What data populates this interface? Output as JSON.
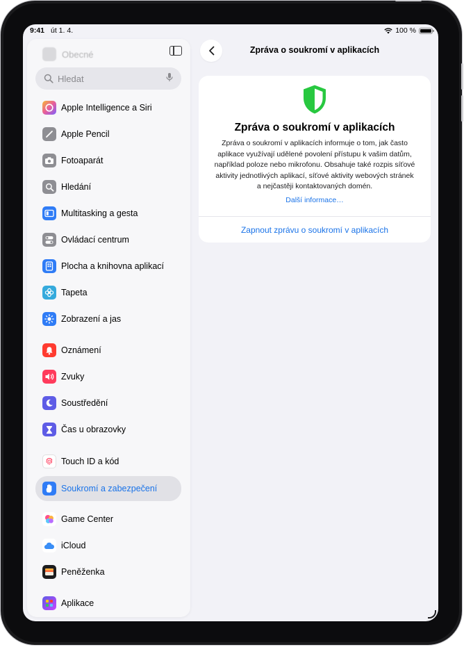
{
  "status": {
    "time": "9:41",
    "date": "út 1. 4.",
    "battery": "100 %"
  },
  "sidebar": {
    "faded_item": "Obecné",
    "search_placeholder": "Hledat",
    "items": [
      {
        "label": "Apple Intelligence a Siri",
        "icon": "sparkle-icon",
        "color": "#e85d9b"
      },
      {
        "label": "Apple Pencil",
        "icon": "pencil-icon",
        "color": "#8e8e93"
      },
      {
        "label": "Fotoaparát",
        "icon": "camera-icon",
        "color": "#8e8e93"
      },
      {
        "label": "Hledání",
        "icon": "search-icon",
        "color": "#8e8e93"
      },
      {
        "label": "Multitasking a gesta",
        "icon": "multitasking-icon",
        "color": "#2f7cf6"
      },
      {
        "label": "Ovládací centrum",
        "icon": "toggles-icon",
        "color": "#8e8e93"
      },
      {
        "label": "Plocha a knihovna aplikací",
        "icon": "home-screen-icon",
        "color": "#2f7cf6"
      },
      {
        "label": "Tapeta",
        "icon": "flower-icon",
        "color": "#35aadc"
      },
      {
        "label": "Zobrazení a jas",
        "icon": "sun-icon",
        "color": "#2f7cf6"
      },
      {
        "label": "Oznámení",
        "icon": "bell-icon",
        "color": "#ff3b30"
      },
      {
        "label": "Zvuky",
        "icon": "speaker-icon",
        "color": "#ff3b5c"
      },
      {
        "label": "Soustředění",
        "icon": "moon-icon",
        "color": "#5e5ce6"
      },
      {
        "label": "Čas u obrazovky",
        "icon": "hourglass-icon",
        "color": "#5e5ce6"
      },
      {
        "label": "Touch ID a kód",
        "icon": "fingerprint-icon",
        "color": "#ffffff"
      },
      {
        "label": "Soukromí a zabezpečení",
        "icon": "hand-icon",
        "color": "#2f7cf6"
      },
      {
        "label": "Game Center",
        "icon": "game-center-icon",
        "color": "#ffffff"
      },
      {
        "label": "iCloud",
        "icon": "cloud-icon",
        "color": "#ffffff"
      },
      {
        "label": "Peněženka",
        "icon": "wallet-icon",
        "color": "#1c1c1e"
      },
      {
        "label": "Aplikace",
        "icon": "apps-grid-icon",
        "color": "#5e5ce6"
      }
    ],
    "selected_index": 14
  },
  "detail": {
    "title": "Zpráva o soukromí v aplikacích",
    "card": {
      "heading": "Zpráva o soukromí v aplikacích",
      "body_lines": [
        "Zpráva o soukromí v aplikacích informuje o tom, jak často",
        "aplikace využívají udělené povolení přístupu k vašim datům,",
        "například poloze nebo mikrofonu. Obsahuje také rozpis síťové",
        "aktivity jednotlivých aplikací, síťové aktivity webových stránek",
        "a nejčastěji kontaktovaných domén."
      ],
      "link": "Další informace…",
      "action": "Zapnout zprávu o soukromí v aplikacích",
      "shield_color": "#28c840"
    }
  }
}
